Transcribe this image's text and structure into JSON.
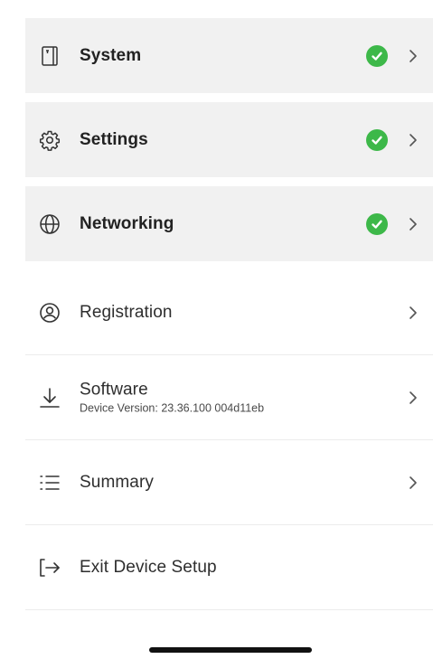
{
  "menu": {
    "items": [
      {
        "label": "System",
        "icon": "tablet-icon",
        "status": "complete"
      },
      {
        "label": "Settings",
        "icon": "gear-icon",
        "status": "complete"
      },
      {
        "label": "Networking",
        "icon": "globe-icon",
        "status": "complete"
      },
      {
        "label": "Registration",
        "icon": "user-circle-icon"
      },
      {
        "label": "Software",
        "sublabel": "Device Version: 23.36.100 004d11eb",
        "icon": "download-icon"
      },
      {
        "label": "Summary",
        "icon": "list-icon"
      },
      {
        "label": "Exit Device Setup",
        "icon": "exit-icon"
      }
    ]
  },
  "colors": {
    "completed_row_bg": "#f1f1f1",
    "check_green": "#3db849"
  }
}
